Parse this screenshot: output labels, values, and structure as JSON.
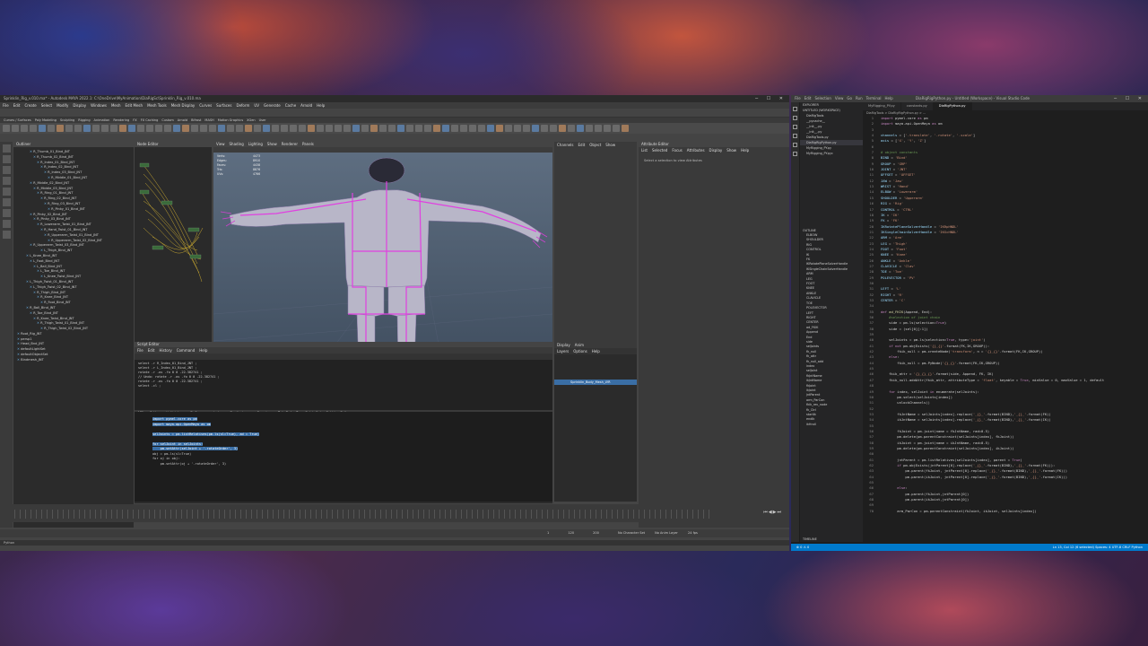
{
  "maya": {
    "title": "Sprinklin_Rig_v.010.ma* - Autodesk MAYA 2022.1: C:\\OneDrive\\MyAnimation\\DiaRigSc\\Sprinklin_Rig_v.010.ma",
    "menu": [
      "File",
      "Edit",
      "Create",
      "Select",
      "Modify",
      "Display",
      "Windows",
      "Mesh",
      "Edit Mesh",
      "Mesh Tools",
      "Mesh Display",
      "Curves",
      "Surfaces",
      "Deform",
      "UV",
      "Generate",
      "Cache",
      "Arnold",
      "Help"
    ],
    "shelf_tabs": [
      "Curves / Surfaces",
      "Poly Modeling",
      "Sculpting",
      "Rigging",
      "Animation",
      "Rendering",
      "FX",
      "FX Caching",
      "Custom",
      "Arnold",
      "Bifrost",
      "MASH",
      "Motion Graphics",
      "XGen",
      "User"
    ],
    "outliner_title": "Outliner",
    "outliner_rows": [
      "R_Thumb_01_Bind_JNT",
      "R_Thumb_02_Bind_JNT",
      "R_Index_01_Bind_JNT",
      "R_Index_02_Bind_JNT",
      "R_Index_03_Bind_JNT",
      "R_Middle_01_Bind_JNT",
      "R_Middle_02_Bind_JNT",
      "R_Middle_03_Bind_JNT",
      "R_Ring_01_Bind_JNT",
      "R_Ring_02_Bind_JNT",
      "R_Ring_03_Bind_JNT",
      "R_Pinky_01_Bind_JNT",
      "R_Pinky_02_Bind_JNT",
      "R_Pinky_03_Bind_JNT",
      "R_Lowerarm_Twist_01_Bind_JNT",
      "R_Hand_Twist_01_Bind_JNT",
      "R_Upperarm_Twist_01_Bind_JNT",
      "R_Upperarm_Twist_02_Bind_JNT",
      "R_Upperarm_Twist_03_Bind_JNT",
      "L_Thigh_Bind_JNT",
      "L_Knee_Bind_JNT",
      "L_Foot_Bind_JNT",
      "L_Ball_Bind_JNT",
      "L_Toe_Bind_JNT",
      "L_Knee_Twist_Bind_JNT",
      "L_Thigh_Twist_01_Bind_JNT",
      "L_Thigh_Twist_02_Bind_JNT",
      "R_Thigh_Bind_JNT",
      "R_Knee_Bind_JNT",
      "R_Foot_Bind_JNT",
      "R_Ball_Bind_JNT",
      "R_Toe_Bind_JNT",
      "R_Knee_Twist_Bind_JNT",
      "R_Thigh_Twist_01_Bind_JNT",
      "R_Thigh_Twist_02_Bind_JNT",
      "Root_Rig_JNT",
      "persp1",
      "Head_Bnd_JNT",
      "defaultLightSet",
      "defaultObjectSet",
      "Bindmesh_JNT"
    ],
    "nodeeditor_title": "Node Editor",
    "viewport_menu": [
      "View",
      "Shading",
      "Lighting",
      "Show",
      "Renderer",
      "Panels"
    ],
    "hud": {
      "labels": [
        "Verts:",
        "Edges:",
        "Faces:",
        "Tris:",
        "UVs:"
      ],
      "values": [
        "4473",
        "8910",
        "4438",
        "8876",
        "4766"
      ]
    },
    "hud_br": {
      "labels": [
        "Playback Speed:",
        "Current Character:",
        "IK Blend:"
      ],
      "values": [
        "Real-time [fps]",
        "No Character",
        "No Driver"
      ],
      "fps": "121.1 fps"
    },
    "channel_menu": [
      "Channels",
      "Edit",
      "Object",
      "Show"
    ],
    "attr_title": "Attribute Editor",
    "attr_menu": [
      "List",
      "Selected",
      "Focus",
      "Attributes",
      "Display",
      "Show",
      "Help"
    ],
    "attr_msg": "Select a selection to view Attributes",
    "attr_button": "Load Attributes",
    "script_title": "Script Editor",
    "script_menu": [
      "File",
      "Edit",
      "History",
      "Command",
      "Help"
    ],
    "script_history": "select -r R_Index_01_Bind_JNT ;\nselect -r L_Index_01_Bind_JNT ;\nrotate -r -os -fo 0 0 -22.382741 ;\n// Undo: rotate -r -os -fo 0 0 -22.382741 ;\nrotate -r -os -fo 0 0 -22.382741 ;\nselect -cl ;",
    "script_tabs": [
      "MEL",
      "Python",
      "ListJoints.py",
      "TryFunc_py",
      "test_py",
      "Duplicator_py",
      "Parent_py",
      "BakeOrder_Py",
      "RotateOrder_Rebld",
      "Python"
    ],
    "script_code_sel": "import pymel.core as pm\nimport maya.api.OpenMaya as om\n\nselJoints = pm.listRelatives(pm.ls(sl=True), ad = True)\n\nfor selJoint in selJoints:\n    pm.setAttr(selJoint + '.rotateOrder', 3)",
    "script_code_rest": "\nobj = pm.ls(sl=True)\nfor oj in obj:\n    pm.setAttr(oj + '.rotateOrder', 3)",
    "layer_menu": [
      "Display",
      "Anim"
    ],
    "layer_sub": [
      "Layers",
      "Options",
      "Help"
    ],
    "layer_name": "Sprinklin_Body_Mesh_LYR",
    "range": [
      "1",
      "120",
      "200"
    ],
    "range_labels": [
      "No Character Set",
      "No Anim Layer",
      "24 fps"
    ],
    "cmd_lang": "Python"
  },
  "vscode": {
    "title": "DiaRigRigPython.py - Untitled (Workspace) - Visual Studio Code",
    "menu": [
      "File",
      "Edit",
      "Selection",
      "View",
      "Go",
      "Run",
      "Terminal",
      "Help"
    ],
    "explorer_title": "EXPLORER",
    "workspace": "UNTITLED (WORKSPACE)",
    "files": [
      "DiaRigTools",
      "__pycache__",
      "__init__.py",
      "__init__.py",
      "DiaRigTools.py",
      "DiaRigRigPython.py",
      "MyRigging_PY.py",
      "MyRigging_PY.pyc"
    ],
    "outline_title": "OUTLINE",
    "outline_items": [
      "ELBOW",
      "SHOULDER",
      "RIG",
      "CONTROL",
      "IK",
      "FK",
      "IKRotatePlaneSolverHandle",
      "IKSingleChainSolverHandle",
      "ARM",
      "LEG",
      "FOOT",
      "KNEE",
      "ANKLE",
      "CLAVICLE",
      "TOE",
      "POLEVECTOR",
      "LEFT",
      "RIGHT",
      "CENTER",
      "ad_FKIK",
      "Append",
      "End",
      "side",
      "selJoints",
      "fk_null",
      "fk_attr",
      "fk_null_add",
      "index",
      "selJoint",
      "fkJntName",
      "ikJntName",
      "fkJoint",
      "ikJoint",
      "jntParent",
      "arm_ParCon",
      "fkik_rev_node",
      "fk_Ctrl",
      "startIk",
      "endIk",
      "ikHndl"
    ],
    "timeline": "TIMELINE",
    "tabs": [
      "MyRigging_PY.py",
      "constants.py",
      "DiaRigPython.py"
    ],
    "breadcrumb": "DiaRigTools > DiaRigRigPython.py > ...",
    "status_left": "⊗ 0  ⚠ 0",
    "status_right": "Ln 13, Col 12 (6 selected)   Spaces: 4   UTF-8   CRLF   Python"
  },
  "colors": {
    "maya_select": "#3a6ea5",
    "vscode_status": "#007acc",
    "rig_magenta": "#e040e0"
  }
}
